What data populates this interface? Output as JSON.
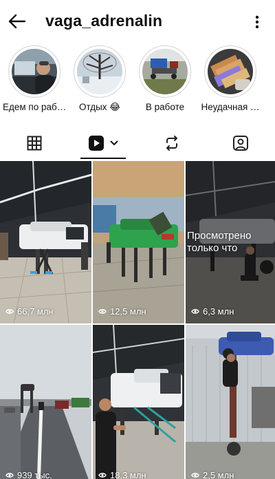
{
  "header": {
    "username": "vaga_adrenalin",
    "back_icon": "arrow-left-icon",
    "menu_icon": "more-vertical-icon"
  },
  "highlights": [
    {
      "label": "Едем по раб…",
      "icon": "driver-photo"
    },
    {
      "label": "Отдых 😂",
      "icon": "winter-tree-photo"
    },
    {
      "label": "В работе",
      "icon": "car-parts-photo"
    },
    {
      "label": "Неудачная …",
      "icon": "money-photo"
    }
  ],
  "tabs": [
    {
      "name": "grid-tab",
      "icon": "grid-icon"
    },
    {
      "name": "reels-tab",
      "icon": "reels-icon",
      "active": true
    },
    {
      "name": "reposts-tab",
      "icon": "repost-icon"
    },
    {
      "name": "tagged-tab",
      "icon": "tagged-person-icon"
    }
  ],
  "reels": [
    {
      "views": "66,7 млн"
    },
    {
      "views": "12,5 млн"
    },
    {
      "views": "6,3 млн",
      "overlay": "Просмотрено только что"
    },
    {
      "views": "939 тыс."
    },
    {
      "views": "18,3 млн"
    },
    {
      "views": "2,5 млн"
    }
  ],
  "colors": {
    "accent": "#111111",
    "background": "#ffffff",
    "divider": "#dbdbdb"
  }
}
